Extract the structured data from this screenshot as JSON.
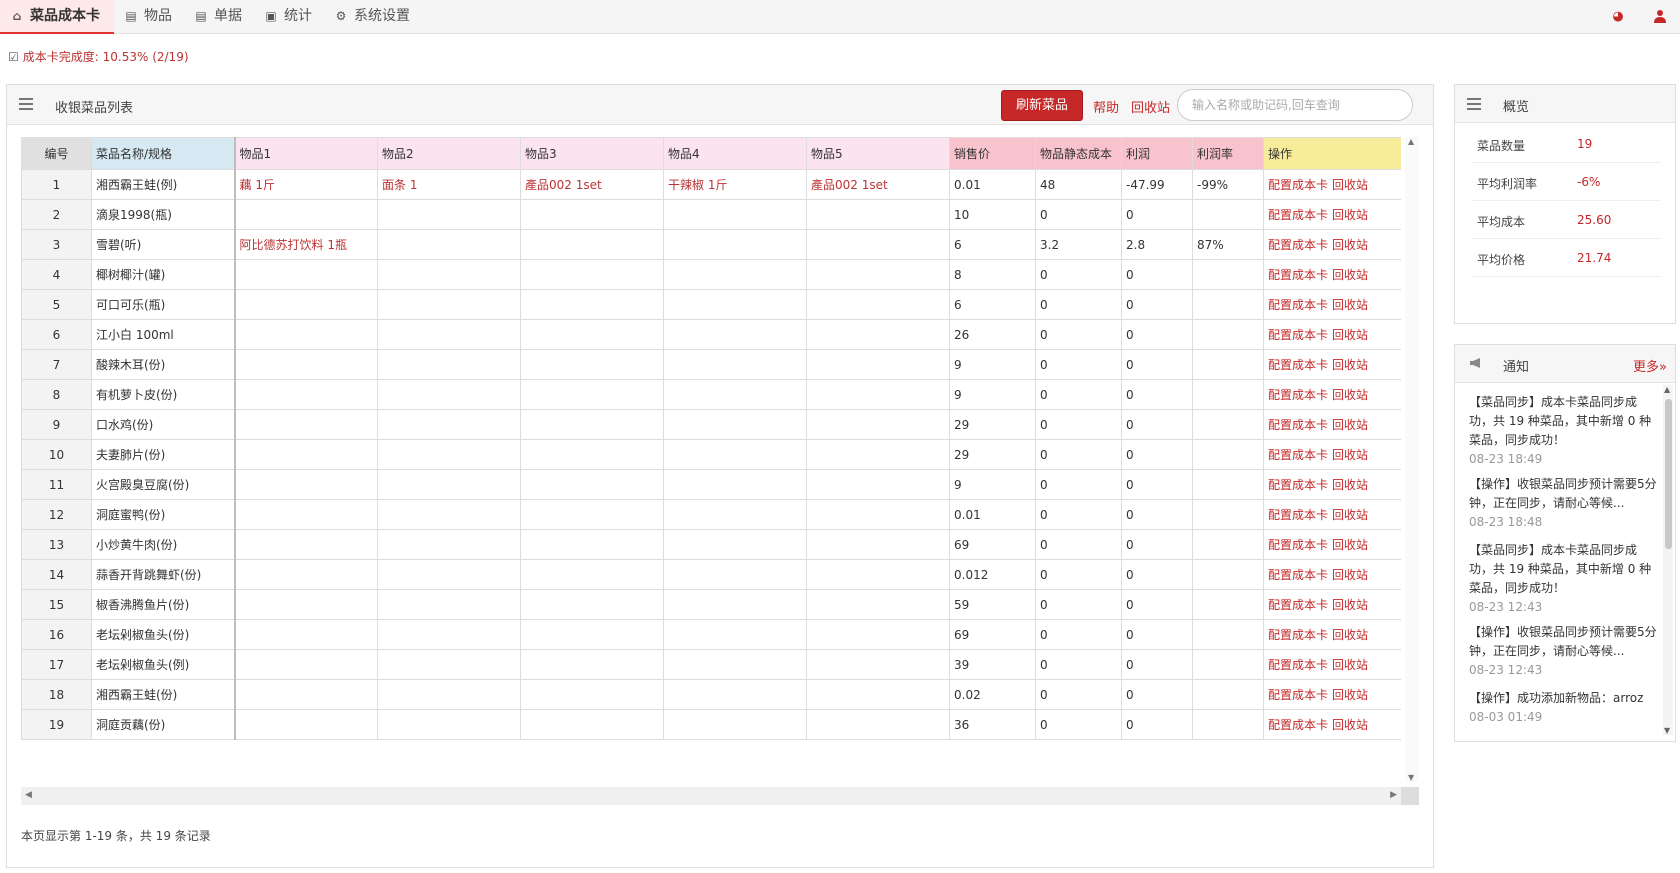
{
  "nav": {
    "items": [
      {
        "icon": "home-icon",
        "glyph": "⌂",
        "label": "菜品成本卡",
        "active": true
      },
      {
        "icon": "list-icon",
        "glyph": "▤",
        "label": "物品"
      },
      {
        "icon": "document-icon",
        "glyph": "▤",
        "label": "单据"
      },
      {
        "icon": "image-icon",
        "glyph": "▣",
        "label": "统计"
      },
      {
        "icon": "gear-icon",
        "glyph": "⚙",
        "label": "系统设置"
      }
    ]
  },
  "progress": {
    "text": "成本卡完成度: 10.53% (2/19)"
  },
  "panel": {
    "title": "收银菜品列表",
    "refresh_label": "刷新菜品",
    "help_label": "帮助",
    "recycle_label": "回收站",
    "search_placeholder": "输入名称或助记码,回车查询"
  },
  "table": {
    "headers": [
      "编号",
      "菜品名称/规格",
      "物品1",
      "物品2",
      "物品3",
      "物品4",
      "物品5",
      "销售价",
      "物品静态成本",
      "利润",
      "利润率",
      "操作"
    ],
    "op_config": "配置成本卡",
    "op_recycle": "回收站",
    "rows": [
      {
        "id": "1",
        "name": "湘西霸王蛙(例)",
        "items": [
          "藕 1斤",
          "面条 1",
          "產品002 1set",
          "干辣椒 1斤",
          "產品002 1set"
        ],
        "price": "0.01",
        "cost": "48",
        "profit": "-47.99",
        "rate": "-99%"
      },
      {
        "id": "2",
        "name": "滴泉1998(瓶)",
        "items": [
          "",
          "",
          "",
          "",
          ""
        ],
        "price": "10",
        "cost": "0",
        "profit": "0",
        "rate": ""
      },
      {
        "id": "3",
        "name": "雪碧(听)",
        "items": [
          "阿比德苏打饮料 1瓶",
          "",
          "",
          "",
          ""
        ],
        "price": "6",
        "cost": "3.2",
        "profit": "2.8",
        "rate": "87%"
      },
      {
        "id": "4",
        "name": "椰树椰汁(罐)",
        "items": [
          "",
          "",
          "",
          "",
          ""
        ],
        "price": "8",
        "cost": "0",
        "profit": "0",
        "rate": ""
      },
      {
        "id": "5",
        "name": "可口可乐(瓶)",
        "items": [
          "",
          "",
          "",
          "",
          ""
        ],
        "price": "6",
        "cost": "0",
        "profit": "0",
        "rate": ""
      },
      {
        "id": "6",
        "name": "江小白 100ml",
        "items": [
          "",
          "",
          "",
          "",
          ""
        ],
        "price": "26",
        "cost": "0",
        "profit": "0",
        "rate": ""
      },
      {
        "id": "7",
        "name": "酸辣木耳(份)",
        "items": [
          "",
          "",
          "",
          "",
          ""
        ],
        "price": "9",
        "cost": "0",
        "profit": "0",
        "rate": ""
      },
      {
        "id": "8",
        "name": "有机萝卜皮(份)",
        "items": [
          "",
          "",
          "",
          "",
          ""
        ],
        "price": "9",
        "cost": "0",
        "profit": "0",
        "rate": ""
      },
      {
        "id": "9",
        "name": "口水鸡(份)",
        "items": [
          "",
          "",
          "",
          "",
          ""
        ],
        "price": "29",
        "cost": "0",
        "profit": "0",
        "rate": ""
      },
      {
        "id": "10",
        "name": "夫妻肺片(份)",
        "items": [
          "",
          "",
          "",
          "",
          ""
        ],
        "price": "29",
        "cost": "0",
        "profit": "0",
        "rate": ""
      },
      {
        "id": "11",
        "name": "火宫殿臭豆腐(份)",
        "items": [
          "",
          "",
          "",
          "",
          ""
        ],
        "price": "9",
        "cost": "0",
        "profit": "0",
        "rate": ""
      },
      {
        "id": "12",
        "name": "洞庭蜜鸭(份)",
        "items": [
          "",
          "",
          "",
          "",
          ""
        ],
        "price": "0.01",
        "cost": "0",
        "profit": "0",
        "rate": ""
      },
      {
        "id": "13",
        "name": "小炒黄牛肉(份)",
        "items": [
          "",
          "",
          "",
          "",
          ""
        ],
        "price": "69",
        "cost": "0",
        "profit": "0",
        "rate": ""
      },
      {
        "id": "14",
        "name": "蒜香开背跳舞虾(份)",
        "items": [
          "",
          "",
          "",
          "",
          ""
        ],
        "price": "0.012",
        "cost": "0",
        "profit": "0",
        "rate": ""
      },
      {
        "id": "15",
        "name": "椒香沸腾鱼片(份)",
        "items": [
          "",
          "",
          "",
          "",
          ""
        ],
        "price": "59",
        "cost": "0",
        "profit": "0",
        "rate": ""
      },
      {
        "id": "16",
        "name": "老坛剁椒鱼头(份)",
        "items": [
          "",
          "",
          "",
          "",
          ""
        ],
        "price": "69",
        "cost": "0",
        "profit": "0",
        "rate": ""
      },
      {
        "id": "17",
        "name": "老坛剁椒鱼头(例)",
        "items": [
          "",
          "",
          "",
          "",
          ""
        ],
        "price": "39",
        "cost": "0",
        "profit": "0",
        "rate": ""
      },
      {
        "id": "18",
        "name": "湘西霸王蛙(份)",
        "items": [
          "",
          "",
          "",
          "",
          ""
        ],
        "price": "0.02",
        "cost": "0",
        "profit": "0",
        "rate": ""
      },
      {
        "id": "19",
        "name": "洞庭贡藕(份)",
        "items": [
          "",
          "",
          "",
          "",
          ""
        ],
        "price": "36",
        "cost": "0",
        "profit": "0",
        "rate": ""
      }
    ]
  },
  "pageinfo": "本页显示第 1-19 条，共 19 条记录",
  "overview": {
    "title": "概览",
    "stats": [
      {
        "label": "菜品数量",
        "value": "19"
      },
      {
        "label": "平均利润率",
        "value": "-6%"
      },
      {
        "label": "平均成本",
        "value": "25.60"
      },
      {
        "label": "平均价格",
        "value": "21.74"
      }
    ]
  },
  "notice": {
    "title": "通知",
    "more": "更多»",
    "items": [
      {
        "text": "【菜品同步】成本卡菜品同步成功，共 19 种菜品，其中新增 0 种菜品，同步成功！",
        "time": "08-23 18:49"
      },
      {
        "text": "【操作】收银菜品同步预计需要5分钟，正在同步，请耐心等候...",
        "time": "08-23 18:48"
      },
      {
        "text": "【菜品同步】成本卡菜品同步成功，共 19 种菜品，其中新增 0 种菜品，同步成功！",
        "time": "08-23 12:43"
      },
      {
        "text": "【操作】收银菜品同步预计需要5分钟，正在同步，请耐心等候...",
        "time": "08-23 12:43"
      },
      {
        "text": "【操作】成功添加新物品：arroz",
        "time": "08-03 01:49"
      }
    ]
  },
  "colors": {
    "accent": "#c62828",
    "header_item": "#fbe4f0",
    "header_price": "#f9c3cd",
    "header_op": "#f7ec9a",
    "header_name": "#d6e8f2"
  }
}
